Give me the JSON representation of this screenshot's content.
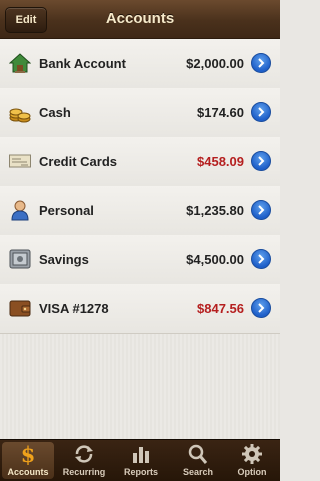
{
  "header": {
    "edit_label": "Edit",
    "title": "Accounts"
  },
  "accounts": [
    {
      "name": "Bank Account",
      "amount": "$2,000.00",
      "negative": false,
      "icon": "bank-house-icon"
    },
    {
      "name": "Cash",
      "amount": "$174.60",
      "negative": false,
      "icon": "coins-icon"
    },
    {
      "name": "Credit Cards",
      "amount": "$458.09",
      "negative": true,
      "icon": "check-card-icon"
    },
    {
      "name": "Personal",
      "amount": "$1,235.80",
      "negative": false,
      "icon": "person-icon"
    },
    {
      "name": "Savings",
      "amount": "$4,500.00",
      "negative": false,
      "icon": "safe-icon"
    },
    {
      "name": "VISA #1278",
      "amount": "$847.56",
      "negative": true,
      "icon": "wallet-icon"
    }
  ],
  "tabs": [
    {
      "label": "Accounts",
      "icon": "dollar-icon",
      "active": true
    },
    {
      "label": "Recurring",
      "icon": "recurring-arrows-icon",
      "active": false
    },
    {
      "label": "Reports",
      "icon": "bar-chart-icon",
      "active": false
    },
    {
      "label": "Search",
      "icon": "magnifier-icon",
      "active": false
    },
    {
      "label": "Option",
      "icon": "gear-icon",
      "active": false
    }
  ],
  "colors": {
    "negative": "#b51f1f",
    "nav_brown": "#4a311c",
    "disclosure_blue": "#1e5fc9"
  }
}
